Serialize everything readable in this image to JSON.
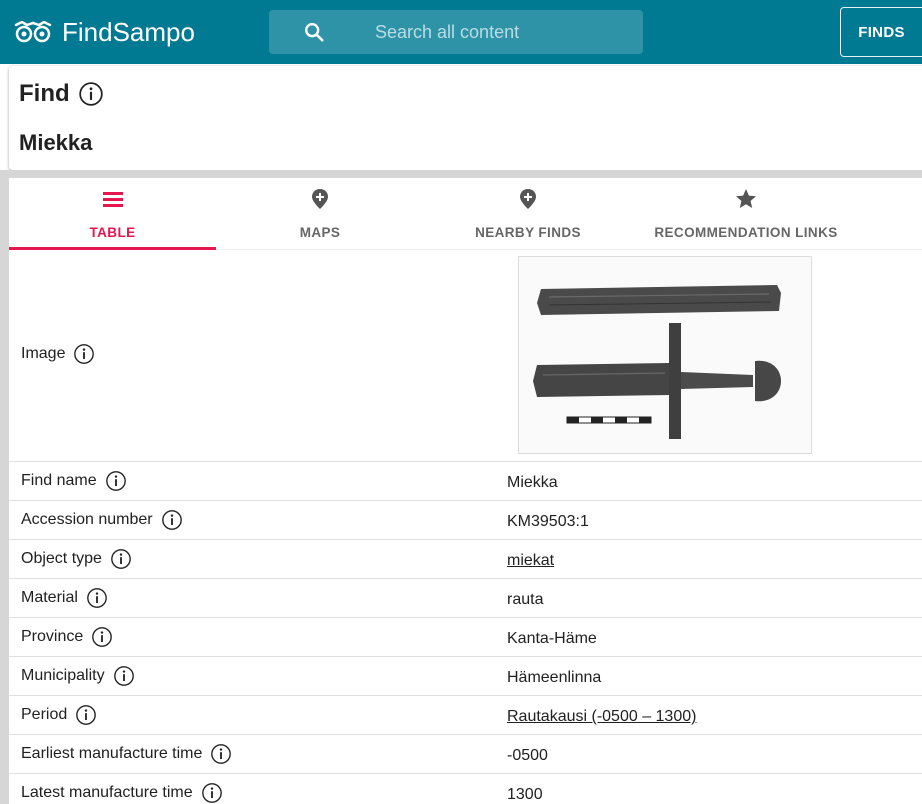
{
  "app": {
    "brand": "FindSampo",
    "search_placeholder": "Search all content",
    "finds_button": "FINDS",
    "accent_color": "#007a93"
  },
  "header": {
    "label": "Find",
    "title": "Miekka"
  },
  "tabs": [
    {
      "label": "TABLE",
      "icon": "list-icon",
      "active": true
    },
    {
      "label": "MAPS",
      "icon": "map-pin-icon",
      "active": false
    },
    {
      "label": "NEARBY FINDS",
      "icon": "map-pin-icon",
      "active": false
    },
    {
      "label": "RECOMMENDATION LINKS",
      "icon": "star-icon",
      "active": false
    }
  ],
  "table": {
    "image_label": "Image",
    "image_alt": "sword-photo",
    "rows": [
      {
        "key": "Find name",
        "value": "Miekka",
        "link": false
      },
      {
        "key": "Accession number",
        "value": "KM39503:1",
        "link": false
      },
      {
        "key": "Object type",
        "value": "miekat",
        "link": true
      },
      {
        "key": "Material",
        "value": "rauta",
        "link": false
      },
      {
        "key": "Province",
        "value": "Kanta-Häme",
        "link": false
      },
      {
        "key": "Municipality",
        "value": "Hämeenlinna",
        "link": false
      },
      {
        "key": "Period",
        "value": "Rautakausi (-0500 – 1300)",
        "link": true
      },
      {
        "key": "Earliest manufacture time",
        "value": "-0500",
        "link": false
      },
      {
        "key": "Latest manufacture time",
        "value": "1300",
        "link": false
      }
    ]
  },
  "colors": {
    "appbar": "#007a93",
    "active_tab": "#e6174e",
    "tab_text": "#666666"
  }
}
